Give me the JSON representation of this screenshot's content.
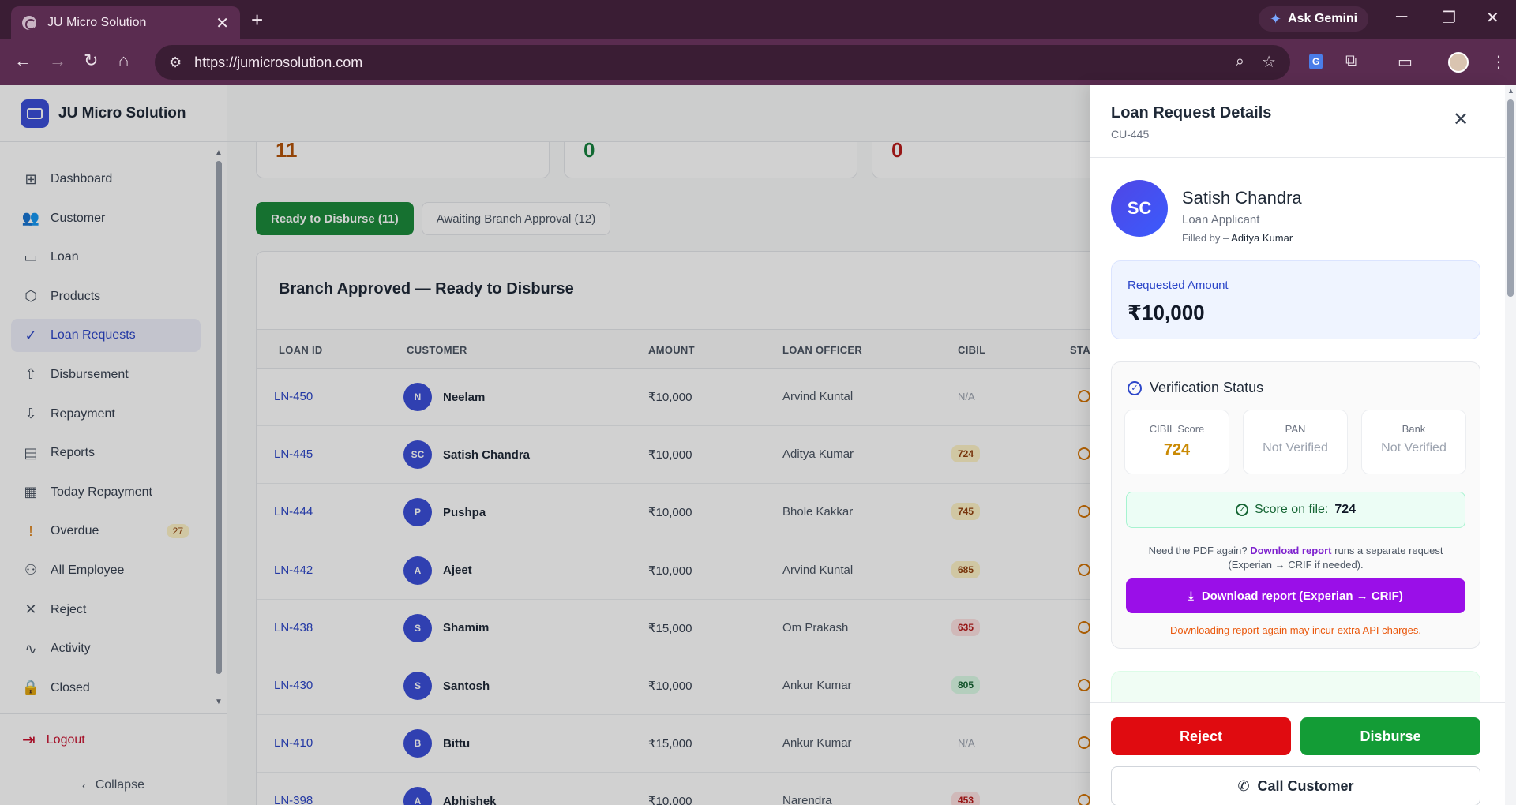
{
  "browser": {
    "tab_title": "JU Micro Solution",
    "tab_close": "✕",
    "new_tab": "+",
    "url": "https://jumicrosolution.com",
    "gemini_label": "Ask Gemini",
    "extension_gt": "G"
  },
  "sidebar": {
    "brand": "JU Micro Solution",
    "items": [
      {
        "label": "Dashboard",
        "icon": "⊞"
      },
      {
        "label": "Customer",
        "icon": "👥"
      },
      {
        "label": "Loan",
        "icon": "▭"
      },
      {
        "label": "Products",
        "icon": "⬡"
      },
      {
        "label": "Loan Requests",
        "icon": "✓"
      },
      {
        "label": "Disbursement",
        "icon": "⇧"
      },
      {
        "label": "Repayment",
        "icon": "⇩"
      },
      {
        "label": "Reports",
        "icon": "▤"
      },
      {
        "label": "Today Repayment",
        "icon": "▦"
      },
      {
        "label": "Overdue",
        "icon": "!",
        "badge": "27"
      },
      {
        "label": "All Employee",
        "icon": "⚇"
      },
      {
        "label": "Reject",
        "icon": "✕"
      },
      {
        "label": "Activity",
        "icon": "∿"
      },
      {
        "label": "Closed",
        "icon": "🔒"
      }
    ],
    "logout": "Logout",
    "collapse": "Collapse"
  },
  "stats": [
    "11",
    "0",
    "0"
  ],
  "stat_colors": [
    "#b45309",
    "#15803d",
    "#b91c1c"
  ],
  "tabs": [
    {
      "label": "Ready to Disburse (11)",
      "active": true
    },
    {
      "label": "Awaiting Branch Approval (12)",
      "active": false
    }
  ],
  "table": {
    "title": "Branch Approved — Ready to Disburse",
    "columns": [
      "LOAN ID",
      "CUSTOMER",
      "AMOUNT",
      "LOAN OFFICER",
      "CIBIL",
      "STA"
    ],
    "rows": [
      {
        "id": "LN-450",
        "initials": "N",
        "customer": "Neelam",
        "amount": "₹10,000",
        "officer": "Arvind Kuntal",
        "cibil": "N/A",
        "cibil_tone": "na"
      },
      {
        "id": "LN-445",
        "initials": "SC",
        "customer": "Satish Chandra",
        "amount": "₹10,000",
        "officer": "Aditya Kumar",
        "cibil": "724",
        "cibil_tone": "amber"
      },
      {
        "id": "LN-444",
        "initials": "P",
        "customer": "Pushpa",
        "amount": "₹10,000",
        "officer": "Bhole Kakkar",
        "cibil": "745",
        "cibil_tone": "amber"
      },
      {
        "id": "LN-442",
        "initials": "A",
        "customer": "Ajeet",
        "amount": "₹10,000",
        "officer": "Arvind Kuntal",
        "cibil": "685",
        "cibil_tone": "amber"
      },
      {
        "id": "LN-438",
        "initials": "S",
        "customer": "Shamim",
        "amount": "₹15,000",
        "officer": "Om Prakash",
        "cibil": "635",
        "cibil_tone": "red"
      },
      {
        "id": "LN-430",
        "initials": "S",
        "customer": "Santosh",
        "amount": "₹10,000",
        "officer": "Ankur Kumar",
        "cibil": "805",
        "cibil_tone": "green"
      },
      {
        "id": "LN-410",
        "initials": "B",
        "customer": "Bittu",
        "amount": "₹15,000",
        "officer": "Ankur Kumar",
        "cibil": "N/A",
        "cibil_tone": "na"
      },
      {
        "id": "LN-398",
        "initials": "A",
        "customer": "Abhishek",
        "amount": "₹10,000",
        "officer": "Narendra",
        "cibil": "453",
        "cibil_tone": "red"
      }
    ]
  },
  "drawer": {
    "title": "Loan Request Details",
    "subtitle": "CU-445",
    "close": "✕",
    "initials": "SC",
    "name": "Satish Chandra",
    "role": "Loan Applicant",
    "filled_by_label": "Filled by –",
    "filled_by": "Aditya Kumar",
    "requested_label": "Requested Amount",
    "requested_value": "₹10,000",
    "verification_title": "Verification Status",
    "checks": [
      {
        "label": "CIBIL Score",
        "value": "724"
      },
      {
        "label": "PAN",
        "value": "Not Verified"
      },
      {
        "label": "Bank",
        "value": "Not Verified"
      }
    ],
    "score_label": "Score on file:",
    "score_value": "724",
    "note_pre": "Need the PDF again?",
    "note_link": "Download report",
    "note_post": "runs a separate request (Experian → CRIF if needed).",
    "download_label": "Download report (Experian → CRIF)",
    "warning": "Downloading report again may incur extra API charges.",
    "reject_label": "Reject",
    "disburse_label": "Disburse",
    "call_label": "Call Customer"
  }
}
